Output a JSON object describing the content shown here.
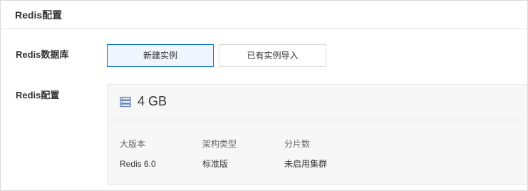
{
  "section": {
    "title": "Redis配置"
  },
  "form": {
    "database_label": "Redis数据库",
    "config_label": "Redis配置"
  },
  "buttons": {
    "new_instance": "新建实例",
    "import_existing": "已有实例导入"
  },
  "config": {
    "capacity": "4 GB",
    "icon": "database-icon",
    "specs": [
      {
        "label": "大版本",
        "value": "Redis 6.0"
      },
      {
        "label": "架构类型",
        "value": "标准版"
      },
      {
        "label": "分片数",
        "value": "未启用集群"
      }
    ]
  },
  "colors": {
    "accent": "#0070cc",
    "selected_bg": "#eef5fd",
    "icon": "#5b7fb5",
    "panel_bg": "#f7f7f7"
  }
}
